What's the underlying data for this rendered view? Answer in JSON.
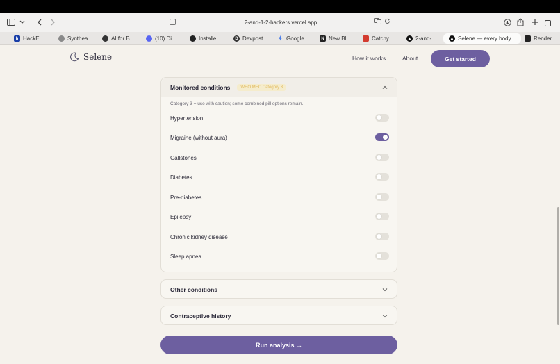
{
  "browser": {
    "url": "2-and-1-2-hackers.vercel.app",
    "tabs": [
      {
        "label": "HackE...",
        "icon": "h-icon",
        "color": "#1a3fa8"
      },
      {
        "label": "Synthea",
        "icon": "synthea-icon",
        "color": "#8a8a8a"
      },
      {
        "label": "AI for B...",
        "icon": "openai-icon",
        "color": "#333333"
      },
      {
        "label": "(10) Di...",
        "icon": "discord-icon",
        "color": "#5865f2"
      },
      {
        "label": "Installe...",
        "icon": "github-icon",
        "color": "#222222"
      },
      {
        "label": "Devpost",
        "icon": "devpost-icon",
        "color": "#333333"
      },
      {
        "label": "Google...",
        "icon": "gemini-icon",
        "color": "#4a7de8"
      },
      {
        "label": "New Bl...",
        "icon": "notion-icon",
        "color": "#222222"
      },
      {
        "label": "Catchy...",
        "icon": "catchy-icon",
        "color": "#d33b2f"
      },
      {
        "label": "2-and-...",
        "icon": "vercel-icon",
        "color": "#111111"
      },
      {
        "label": "Selene — every body...",
        "icon": "vercel-icon",
        "color": "#111111"
      },
      {
        "label": "Render...",
        "icon": "render-icon",
        "color": "#222222"
      }
    ]
  },
  "header": {
    "brand": "Selene",
    "nav": [
      "How it works",
      "About"
    ],
    "cta": "Get started"
  },
  "monitored": {
    "title": "Monitored conditions",
    "badge": "WHO MEC Category 3",
    "note": "Category 3 = use with caution; some combined pill options remain.",
    "conditions": [
      {
        "label": "Hypertension",
        "on": false
      },
      {
        "label": "Migraine (without aura)",
        "on": true
      },
      {
        "label": "Gallstones",
        "on": false
      },
      {
        "label": "Diabetes",
        "on": false
      },
      {
        "label": "Pre-diabetes",
        "on": false
      },
      {
        "label": "Epilepsy",
        "on": false
      },
      {
        "label": "Chronic kidney disease",
        "on": false
      },
      {
        "label": "Sleep apnea",
        "on": false
      }
    ]
  },
  "other": {
    "title": "Other conditions"
  },
  "history": {
    "title": "Contraceptive history"
  },
  "run": {
    "label": "Run analysis →"
  },
  "colors": {
    "accent": "#6d5fa0",
    "background": "#f5f2ec",
    "badge_text": "#e0b85a"
  }
}
